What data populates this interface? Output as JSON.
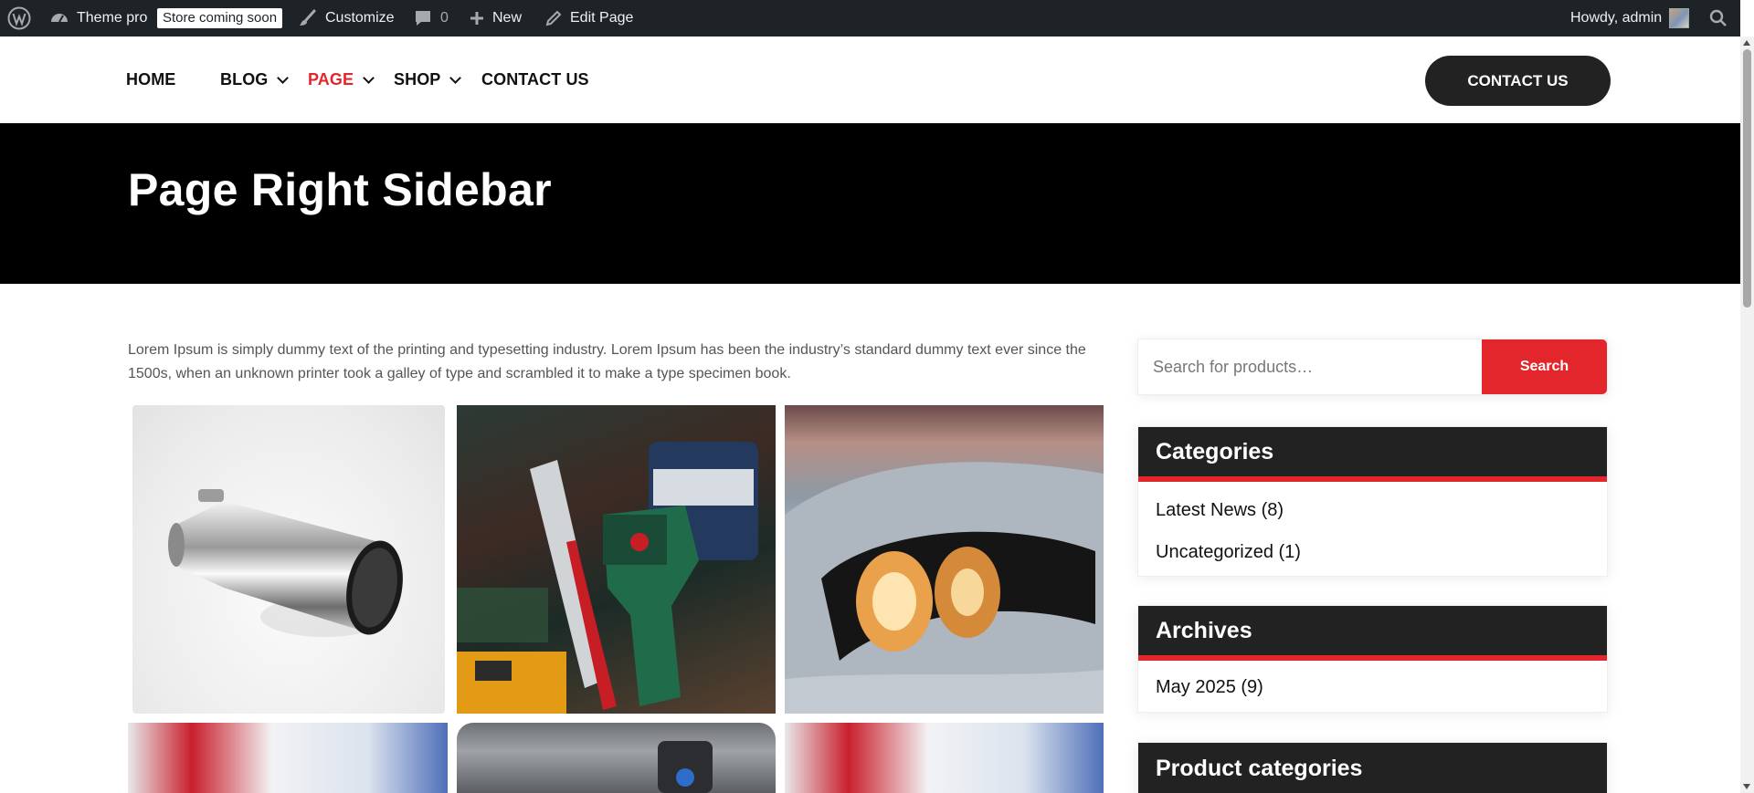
{
  "admin_bar": {
    "site_name": "Theme pro",
    "store_badge": "Store coming soon",
    "customize": "Customize",
    "comments_count": "0",
    "new_label": "New",
    "edit_page": "Edit Page",
    "greeting": "Howdy, admin"
  },
  "nav": {
    "items": [
      {
        "label": "HOME",
        "has_dropdown": false,
        "active": false
      },
      {
        "label": "BLOG",
        "has_dropdown": true,
        "active": false
      },
      {
        "label": "PAGE",
        "has_dropdown": true,
        "active": true
      },
      {
        "label": "SHOP",
        "has_dropdown": true,
        "active": false
      },
      {
        "label": "CONTACT US",
        "has_dropdown": false,
        "active": false
      }
    ],
    "cta_label": "CONTACT US"
  },
  "hero": {
    "title": "Page Right Sidebar"
  },
  "content": {
    "intro": "Lorem Ipsum is simply dummy text of the printing and typesetting industry. Lorem Ipsum has been the industry’s standard dummy text ever since the 1500s, when an unknown printer took a galley of type and scrambled it to make a type specimen book.",
    "gallery_images": [
      "exhaust-tip",
      "power-drill-tools",
      "car-headlight",
      "car-red-blue",
      "car-charger",
      "car-red-blue"
    ]
  },
  "sidebar": {
    "search": {
      "placeholder": "Search for products…",
      "button_label": "Search"
    },
    "categories": {
      "title": "Categories",
      "items": [
        "Latest News (8)",
        "Uncategorized (1)"
      ]
    },
    "archives": {
      "title": "Archives",
      "items": [
        "May 2025 (9)"
      ]
    },
    "product_categories": {
      "title": "Product categories"
    }
  },
  "colors": {
    "admin_bar_bg": "#1d2327",
    "accent": "#e3262b",
    "dark": "#222222",
    "hero_bg": "#000000"
  }
}
